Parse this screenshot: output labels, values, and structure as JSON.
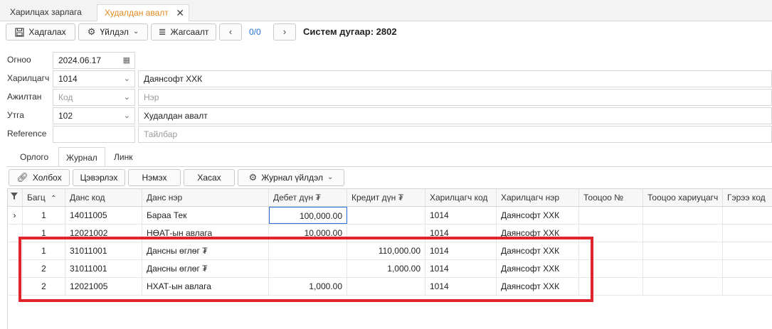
{
  "doc_tabs": [
    {
      "label": "Харилцах зарлага"
    },
    {
      "label": "Худалдан авалт"
    }
  ],
  "toolbar": {
    "save_label": "Хадгалах",
    "actions_label": "Үйлдэл",
    "list_label": "Жагсаалт",
    "pager": "0/0",
    "system_number": "Систем дугаар: 2802"
  },
  "form": {
    "date_label": "Огноо",
    "date_value": "2024.06.17",
    "partner_label": "Харилцагч",
    "partner_code": "1014",
    "partner_name": "Даянсофт ХХК",
    "employee_label": "Ажилтан",
    "employee_code_placeholder": "Код",
    "employee_name_placeholder": "Нэр",
    "purpose_label": "Утга",
    "purpose_code": "102",
    "purpose_name": "Худалдан авалт",
    "reference_label": "Reference",
    "reference_value": "",
    "description_placeholder": "Тайлбар"
  },
  "inner_tabs": [
    {
      "label": "Орлого"
    },
    {
      "label": "Журнал"
    },
    {
      "label": "Линк"
    }
  ],
  "grid_toolbar": {
    "link_label": "Холбох",
    "clear_label": "Цэвэрлэх",
    "add_label": "Нэмэх",
    "remove_label": "Хасах",
    "journal_actions_label": "Журнал үйлдэл"
  },
  "columns": [
    "Багц",
    "Данс код",
    "Данс нэр",
    "Дебет дүн ₮",
    "Кредит дүн ₮",
    "Харилцагч код",
    "Харилцагч нэр",
    "Тооцоо №",
    "Тооцоо хариуцагч",
    "Гэрээ код"
  ],
  "rows": [
    {
      "batch": "1",
      "account_code": "14011005",
      "account_name": "Бараа Тек",
      "debit": "100,000.00",
      "credit": "",
      "partner_code": "1014",
      "partner_name": "Даянсофт ХХК"
    },
    {
      "batch": "1",
      "account_code": "12021002",
      "account_name": "НӨАТ-ын авлага",
      "debit": "10,000.00",
      "credit": "",
      "partner_code": "1014",
      "partner_name": "Даянсофт ХХК"
    },
    {
      "batch": "1",
      "account_code": "31011001",
      "account_name": "Дансны өглөг ₮",
      "debit": "",
      "credit": "110,000.00",
      "partner_code": "1014",
      "partner_name": "Даянсофт ХХК"
    },
    {
      "batch": "2",
      "account_code": "31011001",
      "account_name": "Дансны өглөг ₮",
      "debit": "",
      "credit": "1,000.00",
      "partner_code": "1014",
      "partner_name": "Даянсофт ХХК"
    },
    {
      "batch": "2",
      "account_code": "12021005",
      "account_name": "НХАТ-ын авлага",
      "debit": "1,000.00",
      "credit": "",
      "partner_code": "1014",
      "partner_name": "Даянсофт ХХК"
    }
  ],
  "colors": {
    "active_tab": "#e08a1e",
    "pager": "#1f6fd0",
    "highlight": "#e0242b",
    "selection": "#2a6fd6"
  }
}
